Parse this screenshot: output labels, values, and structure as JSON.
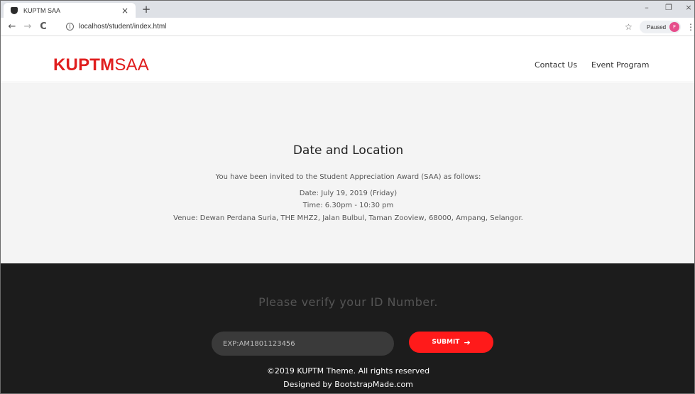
{
  "browser": {
    "tab_title": "KUPTM SAA",
    "tab_close": "×",
    "new_tab": "+",
    "url": "localhost/student/index.html",
    "paused_label": "Paused",
    "avatar_initial": "F",
    "window_controls": {
      "minimize": "–",
      "maximize": "❐",
      "close": "×"
    }
  },
  "header": {
    "logo_bold": "KUPTM",
    "logo_light": "SAA",
    "nav": [
      {
        "label": "Contact Us"
      },
      {
        "label": "Event Program"
      }
    ]
  },
  "info": {
    "title": "Date and Location",
    "intro": "You have been invited to the Student Appreciation Award (SAA) as follows:",
    "date": "Date: July 19, 2019 (Friday)",
    "time": "Time: 6.30pm - 10:30 pm",
    "venue": "Venue: Dewan Perdana Suria, THE MHZ2, Jalan Bulbul, Taman Zooview, 68000, Ampang, Selangor."
  },
  "footer": {
    "verify_heading": "Please verify your ID Number.",
    "id_placeholder": "EXP:AM1801123456",
    "submit_label": "SUBMIT",
    "copyright": "©2019 KUPTM Theme. All rights reserved",
    "designed_by": "Designed by BootstrapMade.com"
  },
  "colors": {
    "brand_red": "#e01e1e",
    "submit_red": "#ff1a1a",
    "footer_bg": "#1c1c1c",
    "info_bg": "#f4f4f4"
  },
  "icons": [
    "favicon-icon",
    "close-icon",
    "new-tab-icon",
    "back-icon",
    "forward-icon",
    "reload-icon",
    "info-icon",
    "star-icon",
    "menu-icon",
    "arrow-right-icon"
  ]
}
